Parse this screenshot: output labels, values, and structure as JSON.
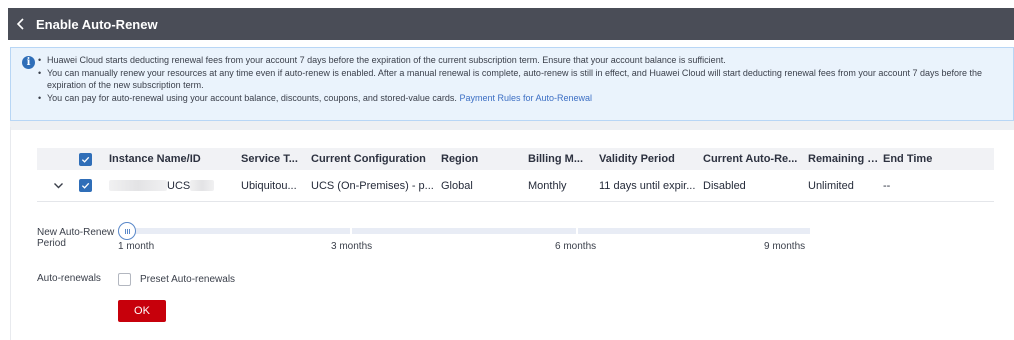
{
  "header": {
    "title": "Enable Auto-Renew"
  },
  "notice": {
    "items": [
      "Huawei Cloud starts deducting renewal fees from your account 7 days before the expiration of the current subscription term. Ensure that your account balance is sufficient.",
      "You can manually renew your resources at any time even if auto-renew is enabled. After a manual renewal is complete, auto-renew is still in effect, and Huawei Cloud will start deducting renewal fees from your account 7 days before the expiration of the new subscription term.",
      "You can pay for auto-renewal using your account balance, discounts, coupons, and stored-value cards."
    ],
    "link_text": "Payment Rules for Auto-Renewal"
  },
  "table": {
    "columns": [
      "Instance Name/ID",
      "Service T...",
      "Current Configuration",
      "Region",
      "Billing M...",
      "Validity Period",
      "Current Auto-Re...",
      "Remaining R...",
      "End Time"
    ],
    "row": {
      "name": "UCS",
      "service": "Ubiquitou...",
      "config": "UCS (On-Premises) - p...",
      "region": "Global",
      "billing": "Monthly",
      "validity": "11 days until expir...",
      "auto_renew": "Disabled",
      "remaining": "Unlimited",
      "end_time": "--"
    }
  },
  "period": {
    "label": "New Auto-Renew Period",
    "ticks": [
      "1 month",
      "3 months",
      "6 months",
      "9 months"
    ],
    "selected": "1 month"
  },
  "auto_renewals": {
    "label": "Auto-renewals",
    "checkbox_label": "Preset Auto-renewals",
    "checked": false
  },
  "ok_label": "OK",
  "colors": {
    "header_bg": "#4a4d57",
    "accent": "#2f6eb8",
    "ok_button": "#c7000b",
    "notice_bg": "#eaf3fc"
  },
  "icons": {
    "back": "chevron-left-icon",
    "info": "info-icon",
    "expand": "chevron-down-icon",
    "check": "check-icon",
    "slider": "grip-icon"
  }
}
